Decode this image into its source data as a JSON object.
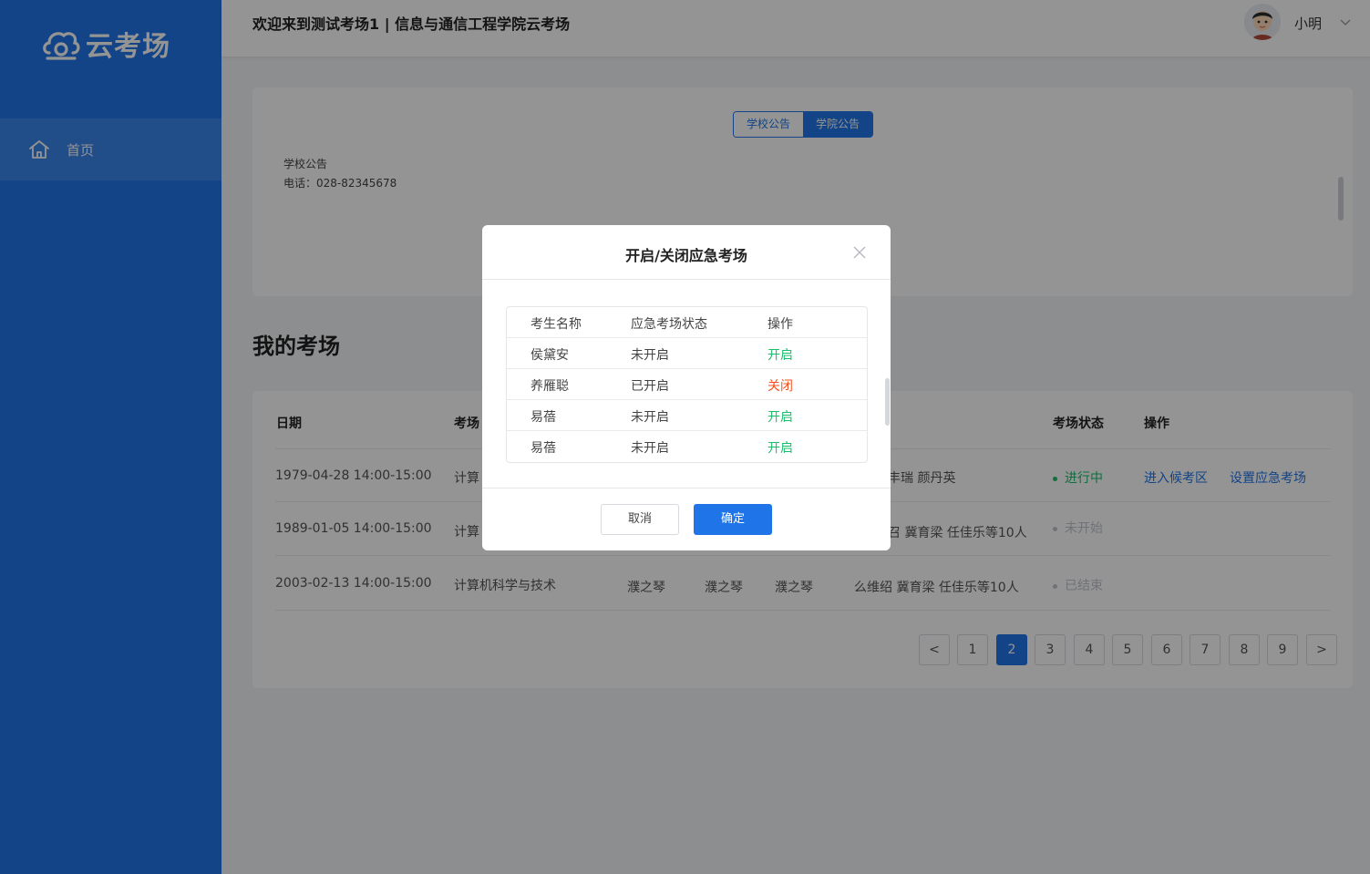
{
  "brand": {
    "logo_text": "云考场"
  },
  "sidebar": {
    "items": [
      {
        "label": "首页",
        "icon": "home-icon"
      }
    ]
  },
  "header": {
    "title": "欢迎来到测试考场1 | 信息与通信工程学院云考场",
    "username": "小明"
  },
  "notice": {
    "tabs": [
      {
        "label": "学校公告",
        "active": false
      },
      {
        "label": "学院公告",
        "active": true
      }
    ],
    "lines": [
      "学校公告",
      "电话：028-82345678"
    ]
  },
  "section_title": "我的考场",
  "exam_table": {
    "headers": [
      "日期",
      "考场",
      "考场状态",
      "操作"
    ],
    "rows": [
      {
        "date": "1979-04-28 14:00-15:00",
        "room": "计算",
        "invigilators": "丰瑞  颜丹英",
        "status": "进行中",
        "status_color": "#19be6b",
        "actions": [
          "进入候考区",
          "设置应急考场"
        ]
      },
      {
        "date": "1989-01-05  14:00-15:00",
        "room": "计算",
        "invigilators": "召  冀育梁  任佳乐等10人",
        "status": "未开始",
        "status_color": "#c0c4cc",
        "actions": []
      },
      {
        "date": "2003-02-13 14:00-15:00",
        "room": "计算机科学与技术",
        "teacher1": "濮之琴",
        "teacher2": "濮之琴",
        "teacher3": "濮之琴",
        "invigilators": "么维绍  冀育梁  任佳乐等10人",
        "status": "已结束",
        "status_color": "#c0c4cc",
        "actions": []
      }
    ]
  },
  "pagination": {
    "prev": "<",
    "next": ">",
    "pages": [
      "1",
      "2",
      "3",
      "4",
      "5",
      "6",
      "7",
      "8",
      "9"
    ],
    "current": "2"
  },
  "modal": {
    "title": "开启/关闭应急考场",
    "headers": [
      "考生名称",
      "应急考场状态",
      "操作"
    ],
    "rows": [
      {
        "name": "侯黛安",
        "state": "未开启",
        "action": "开启",
        "action_color": "#19be6b"
      },
      {
        "name": "养雁聪",
        "state": "已开启",
        "action": "关闭",
        "action_color": "#f5501e"
      },
      {
        "name": "易蓓",
        "state": "未开启",
        "action": "开启",
        "action_color": "#19be6b"
      },
      {
        "name": "易蓓",
        "state": "未开启",
        "action": "开启",
        "action_color": "#19be6b"
      }
    ],
    "cancel_label": "取消",
    "ok_label": "确定"
  },
  "colors": {
    "primary": "#1f75e8",
    "success": "#19be6b",
    "danger": "#f5501e",
    "muted": "#c0c4cc"
  }
}
